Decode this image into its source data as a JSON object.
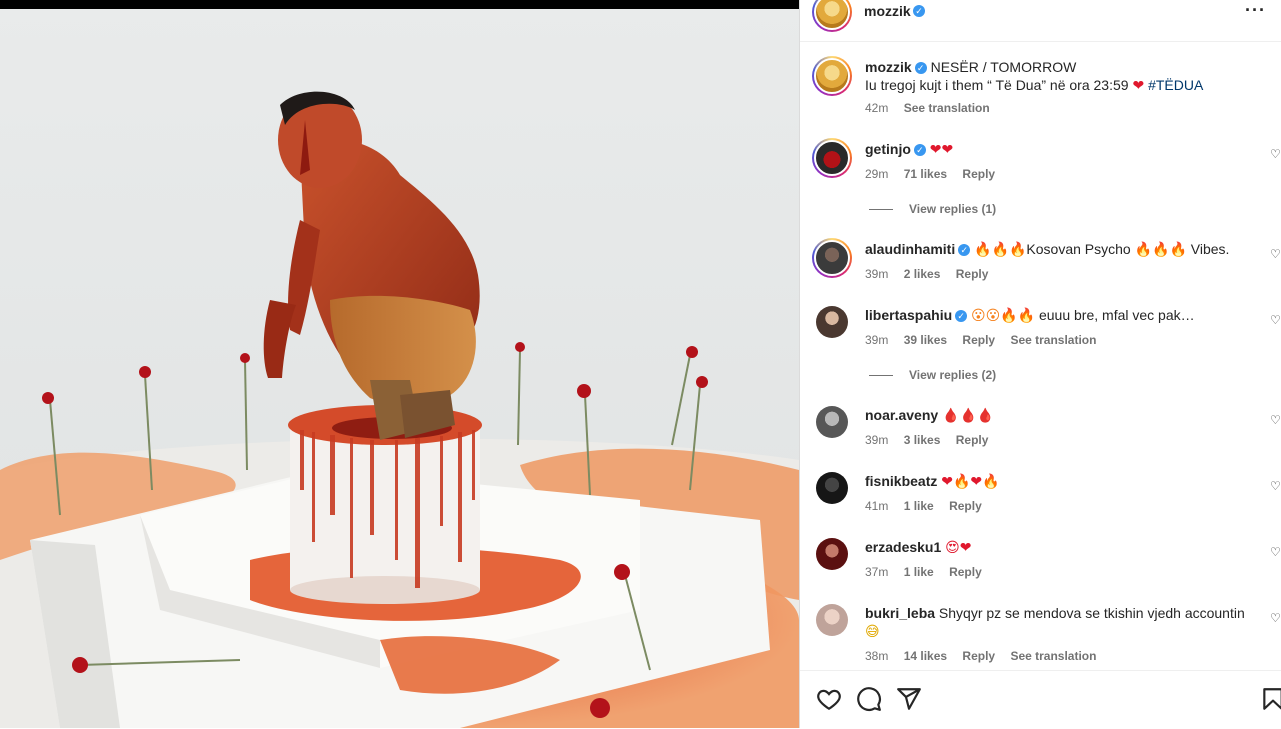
{
  "post": {
    "author": "mozzik"
  },
  "caption": {
    "username": "mozzik",
    "line1": "NESËR / TOMORROW",
    "line2_pre": "Iu tregoj kujt i them “ Të Dua” në ora 23:59 ",
    "line2_emoji": "❤",
    "hashtag": "#TËDUA",
    "time": "42m",
    "see_translation": "See translation"
  },
  "comments": [
    {
      "username": "getinjo",
      "verified": true,
      "text": "",
      "emoji": "❤❤",
      "time": "29m",
      "likes": "71 likes",
      "reply": "Reply",
      "replies": "View replies (1)"
    },
    {
      "username": "alaudinhamiti",
      "verified": true,
      "text_pre": "Kosovan Psycho ",
      "text_post": " Vibes.",
      "emoji": "🔥🔥🔥",
      "time": "39m",
      "likes": "2 likes",
      "reply": "Reply"
    },
    {
      "username": "libertaspahiu",
      "verified": true,
      "text": "euuu bre, mfal vec pak…",
      "emoji": "😮😮🔥🔥",
      "time": "39m",
      "likes": "39 likes",
      "reply": "Reply",
      "see_translation": "See translation",
      "replies": "View replies (2)"
    },
    {
      "username": "noar.aveny",
      "verified": false,
      "text": "",
      "emoji": "🩸🩸🩸",
      "time": "39m",
      "likes": "3 likes",
      "reply": "Reply"
    },
    {
      "username": "fisnikbeatz",
      "verified": false,
      "text": "",
      "emoji": "❤🔥❤🔥",
      "time": "41m",
      "likes": "1 like",
      "reply": "Reply"
    },
    {
      "username": "erzadesku1",
      "verified": false,
      "text": "",
      "emoji": "😍❤",
      "time": "37m",
      "likes": "1 like",
      "reply": "Reply"
    },
    {
      "username": "bukri_leba",
      "verified": false,
      "text": "Shyqyr pz se mendova se tkishin vjedh accountin",
      "emoji": "😅",
      "time": "38m",
      "likes": "14 likes",
      "reply": "Reply",
      "see_translation": "See translation"
    }
  ],
  "icons": {
    "more": "more-options-icon",
    "like": "heart-icon",
    "comment": "comment-icon",
    "share": "share-icon",
    "save": "bookmark-icon"
  },
  "colors": {
    "link": "#00376b",
    "verified": "#3897f0",
    "meta": "#737373",
    "blood": "#c0241b"
  }
}
